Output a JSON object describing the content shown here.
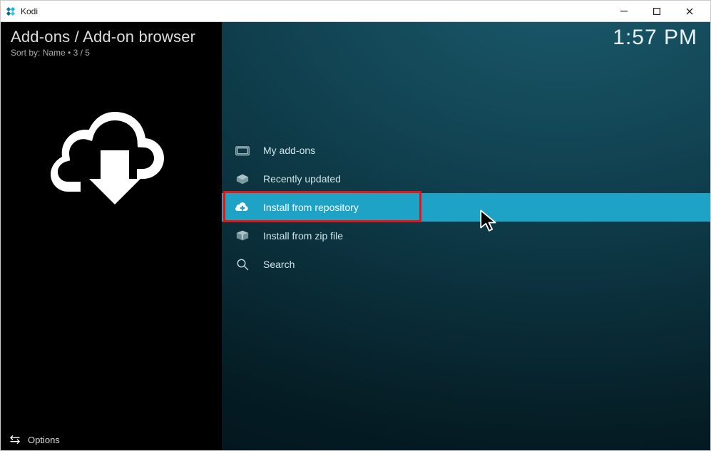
{
  "window": {
    "app": "Kodi"
  },
  "header": {
    "breadcrumb": "Add-ons / Add-on browser",
    "sort_prefix": "Sort by: ",
    "sort_field": "Name",
    "dot": " • ",
    "position": "3 / 5",
    "clock": "1:57 PM"
  },
  "list": {
    "items": [
      {
        "icon": "addons",
        "label": "My add-ons"
      },
      {
        "icon": "recent",
        "label": "Recently updated"
      },
      {
        "icon": "repo",
        "label": "Install from repository"
      },
      {
        "icon": "zip",
        "label": "Install from zip file"
      },
      {
        "icon": "search",
        "label": "Search"
      }
    ]
  },
  "footer": {
    "options": "Options"
  }
}
